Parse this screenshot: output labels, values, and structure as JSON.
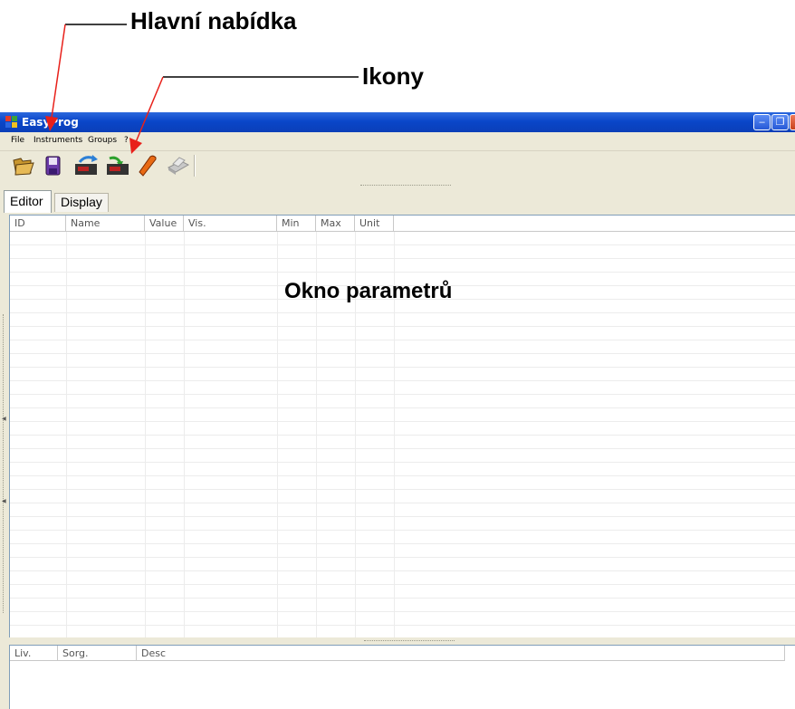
{
  "annotations": {
    "main_menu": "Hlavní nabídka",
    "icons": "Ikony",
    "parameters_window": "Okno parametrů"
  },
  "window": {
    "title": "EasyProg"
  },
  "menu": {
    "items": [
      "File",
      "Instruments",
      "Groups",
      "?"
    ]
  },
  "toolbar": {
    "icons": [
      "open-folder-icon",
      "save-disk-icon",
      "read-instrument-icon",
      "write-instrument-icon",
      "erase-icon",
      "print-icon"
    ]
  },
  "tabs": [
    {
      "label": "Editor",
      "active": true
    },
    {
      "label": "Display",
      "active": false
    }
  ],
  "parameters_table": {
    "columns": [
      "ID",
      "Name",
      "Value",
      "Vis.",
      "Min",
      "Max",
      "Unit"
    ],
    "rows": []
  },
  "detail_table": {
    "columns": [
      "Liv.",
      "Sorg.",
      "Desc"
    ],
    "rows": []
  },
  "colors": {
    "titlebar": "#0a46c9",
    "annotation_arrow": "#e8201a",
    "window_bg": "#ece9d8"
  }
}
